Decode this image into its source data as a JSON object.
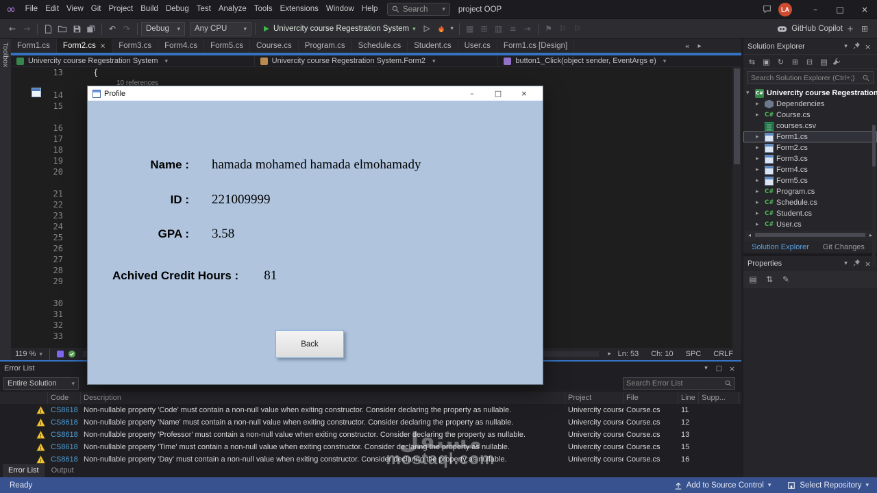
{
  "title_bar": {
    "menus": [
      "File",
      "Edit",
      "View",
      "Git",
      "Project",
      "Build",
      "Debug",
      "Test",
      "Analyze",
      "Tools",
      "Extensions",
      "Window",
      "Help"
    ],
    "search_label": "Search",
    "solution_name": "project OOP",
    "avatar_initials": "LA"
  },
  "icons": {
    "vs_logo": "∞",
    "dropdown": "▾",
    "chevron_right": "▸",
    "overflow": "«",
    "minimize": "–",
    "maximize": "□",
    "close": "×",
    "nav_back": "←",
    "nav_forward": "→",
    "undo": "↶",
    "redo": "↷",
    "misc_grid": "▦",
    "misc_window": "⊞",
    "misc_rows": "▥",
    "misc_list": "≡",
    "misc_indent": "⇥",
    "bookmark_filled": "⚑",
    "bookmark_outline": "⚐",
    "se_compare": "⇆",
    "se_pending": "▣",
    "se_refresh": "↻",
    "se_nest": "⊞",
    "se_collapse": "⊟",
    "se_showall": "▤",
    "props_categorized": "▤",
    "props_sort": "⇅",
    "props_edit": "✎",
    "scroll_left": "◂",
    "scroll_right": "▸",
    "plus": "+"
  },
  "toolbar": {
    "config": "Debug",
    "platform": "Any CPU",
    "run_label": "Univercity course Regestration System",
    "copilot_label": "GitHub Copilot"
  },
  "tabs": [
    {
      "label": "Form1.cs",
      "state": ""
    },
    {
      "label": "Form2.cs",
      "state": "active"
    },
    {
      "label": "Form3.cs",
      "state": ""
    },
    {
      "label": "Form4.cs",
      "state": ""
    },
    {
      "label": "Form5.cs",
      "state": ""
    },
    {
      "label": "Course.cs",
      "state": ""
    },
    {
      "label": "Program.cs",
      "state": ""
    },
    {
      "label": "Schedule.cs",
      "state": ""
    },
    {
      "label": "Student.cs",
      "state": ""
    },
    {
      "label": "User.cs",
      "state": ""
    },
    {
      "label": "Form1.cs [Design]",
      "state": ""
    }
  ],
  "breadcrumb": {
    "project": "Univercity course Regestration System",
    "type": "Univercity course Regestration System.Form2",
    "member": "button1_Click(object sender, EventArgs e)"
  },
  "editor": {
    "first_line_number": "13",
    "open_brace": "{",
    "codelens": "10 references",
    "lines": [
      {
        "n": "14",
        "cls": ""
      },
      {
        "n": "15",
        "cls": ""
      },
      {
        "n": "16",
        "cls": "gap"
      },
      {
        "n": "17",
        "cls": ""
      },
      {
        "n": "18",
        "cls": ""
      },
      {
        "n": "19",
        "cls": ""
      },
      {
        "n": "20",
        "cls": ""
      },
      {
        "n": "21",
        "cls": "gap"
      },
      {
        "n": "22",
        "cls": ""
      },
      {
        "n": "23",
        "cls": ""
      },
      {
        "n": "24",
        "cls": ""
      },
      {
        "n": "25",
        "cls": ""
      },
      {
        "n": "26",
        "cls": ""
      },
      {
        "n": "27",
        "cls": ""
      },
      {
        "n": "28",
        "cls": ""
      },
      {
        "n": "29",
        "cls": ""
      },
      {
        "n": "30",
        "cls": "gap"
      },
      {
        "n": "31",
        "cls": ""
      },
      {
        "n": "32",
        "cls": ""
      },
      {
        "n": "33",
        "cls": ""
      }
    ],
    "zoom": "119 %",
    "status": {
      "line": "Ln: 53",
      "column": "Ch: 10",
      "spaces": "SPC",
      "line_ending": "CRLF"
    }
  },
  "dialog": {
    "title": "Profile",
    "rows": [
      {
        "label": "Name :",
        "value": "hamada mohamed hamada elmohamady"
      },
      {
        "label": "ID :",
        "value": "221009999"
      },
      {
        "label": "GPA :",
        "value": "3.58"
      },
      {
        "label": "Achived Credit Hours :",
        "value": "81"
      }
    ],
    "back_label": "Back"
  },
  "error_list": {
    "title": "Error List",
    "scope": "Entire Solution",
    "search_placeholder": "Search Error List",
    "columns": [
      "",
      "Code",
      "Description",
      "Project",
      "File",
      "Line",
      "Supp..."
    ],
    "rows": [
      {
        "code": "CS8618",
        "description": "Non-nullable property 'Code' must contain a non-null value when exiting constructor. Consider declaring the property as nullable.",
        "project": "Univercity course...",
        "file": "Course.cs",
        "line": "11"
      },
      {
        "code": "CS8618",
        "description": "Non-nullable property 'Name' must contain a non-null value when exiting constructor. Consider declaring the property as nullable.",
        "project": "Univercity course...",
        "file": "Course.cs",
        "line": "12"
      },
      {
        "code": "CS8618",
        "description": "Non-nullable property 'Professor' must contain a non-null value when exiting constructor. Consider declaring the property as nullable.",
        "project": "Univercity course...",
        "file": "Course.cs",
        "line": "13"
      },
      {
        "code": "CS8618",
        "description": "Non-nullable property 'Time' must contain a non-null value when exiting constructor. Consider declaring the property as nullable.",
        "project": "Univercity course...",
        "file": "Course.cs",
        "line": "15"
      },
      {
        "code": "CS8618",
        "description": "Non-nullable property 'Day' must contain a non-null value when exiting constructor. Consider declaring the property as nullable.",
        "project": "Univercity course...",
        "file": "Course.cs",
        "line": "16"
      }
    ],
    "bottom_tabs": [
      {
        "label": "Error List",
        "state": "active"
      },
      {
        "label": "Output",
        "state": ""
      }
    ]
  },
  "solution_explorer": {
    "title": "Solution Explorer",
    "search_placeholder": "Search Solution Explorer (Ctrl+;)",
    "items": [
      {
        "label": "Univercity course Regestration System",
        "icon": "project",
        "cls": "root",
        "chev": "▾"
      },
      {
        "label": "Dependencies",
        "icon": "dependencies",
        "cls": "",
        "chev": "▸"
      },
      {
        "label": "Course.cs",
        "icon": "cs",
        "cls": "",
        "chev": "▸"
      },
      {
        "label": "courses.csv",
        "icon": "csv",
        "cls": "",
        "chev": ""
      },
      {
        "label": "Form1.cs",
        "icon": "form",
        "cls": "focused",
        "chev": "▸"
      },
      {
        "label": "Form2.cs",
        "icon": "form",
        "cls": "",
        "chev": "▸"
      },
      {
        "label": "Form3.cs",
        "icon": "form",
        "cls": "",
        "chev": "▸"
      },
      {
        "label": "Form4.cs",
        "icon": "form",
        "cls": "",
        "chev": "▸"
      },
      {
        "label": "Form5.cs",
        "icon": "form",
        "cls": "",
        "chev": "▸"
      },
      {
        "label": "Program.cs",
        "icon": "cs",
        "cls": "",
        "chev": "▸"
      },
      {
        "label": "Schedule.cs",
        "icon": "cs",
        "cls": "",
        "chev": "▸"
      },
      {
        "label": "Student.cs",
        "icon": "cs",
        "cls": "",
        "chev": "▸"
      },
      {
        "label": "User.cs",
        "icon": "cs",
        "cls": "",
        "chev": "▸"
      }
    ],
    "bottom_tabs": [
      {
        "label": "Solution Explorer",
        "state": "active"
      },
      {
        "label": "Git Changes",
        "state": ""
      }
    ]
  },
  "properties_panel": {
    "title": "Properties"
  },
  "left_strip": {
    "label": "Toolbox"
  },
  "status_bar": {
    "ready": "Ready",
    "source_control": "Add to Source Control",
    "repository": "Select Repository"
  },
  "watermark": {
    "arabic": "مستقل",
    "domain": "mostaql.com"
  },
  "colors": {
    "accent_blue": "#3573c2",
    "status_bar_blue": "#37528f",
    "dialog_body": "#b0c4de",
    "run_green": "#3fb94b",
    "warning_yellow": "#f3c53a",
    "code_link_blue": "#4e9fd6"
  }
}
